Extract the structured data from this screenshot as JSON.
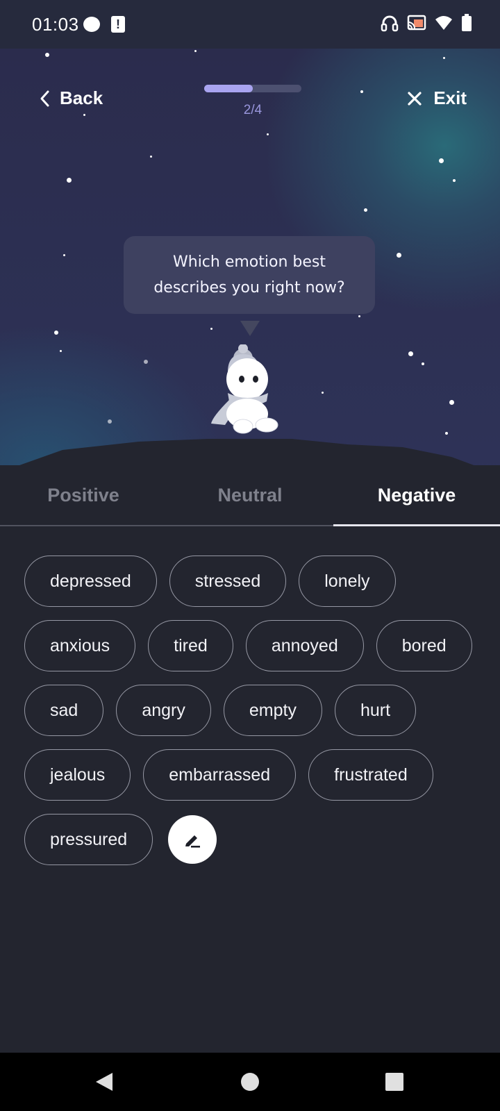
{
  "status_bar": {
    "time": "01:03",
    "icons": [
      "notification-dot-icon",
      "alert-icon",
      "headphones-icon",
      "cast-icon",
      "wifi-icon",
      "battery-icon"
    ]
  },
  "header": {
    "back_label": "Back",
    "exit_label": "Exit",
    "progress": {
      "text": "2/4",
      "fraction": 0.5
    },
    "prompt": "Which emotion best describes you right now?"
  },
  "tabs": [
    {
      "label": "Positive",
      "active": false
    },
    {
      "label": "Neutral",
      "active": false
    },
    {
      "label": "Negative",
      "active": true
    }
  ],
  "emotions": {
    "rows": [
      [
        "depressed",
        "stressed",
        "lonely"
      ],
      [
        "anxious",
        "tired",
        "annoyed",
        "bored"
      ],
      [
        "sad",
        "angry",
        "empty",
        "hurt"
      ],
      [
        "jealous",
        "embarrassed",
        "frustrated"
      ],
      [
        "pressured"
      ]
    ],
    "edit_icon": "pencil-icon"
  },
  "colors": {
    "background": "#23252f",
    "accent": "#a9a4f0",
    "chip_border": "#9698a4"
  }
}
